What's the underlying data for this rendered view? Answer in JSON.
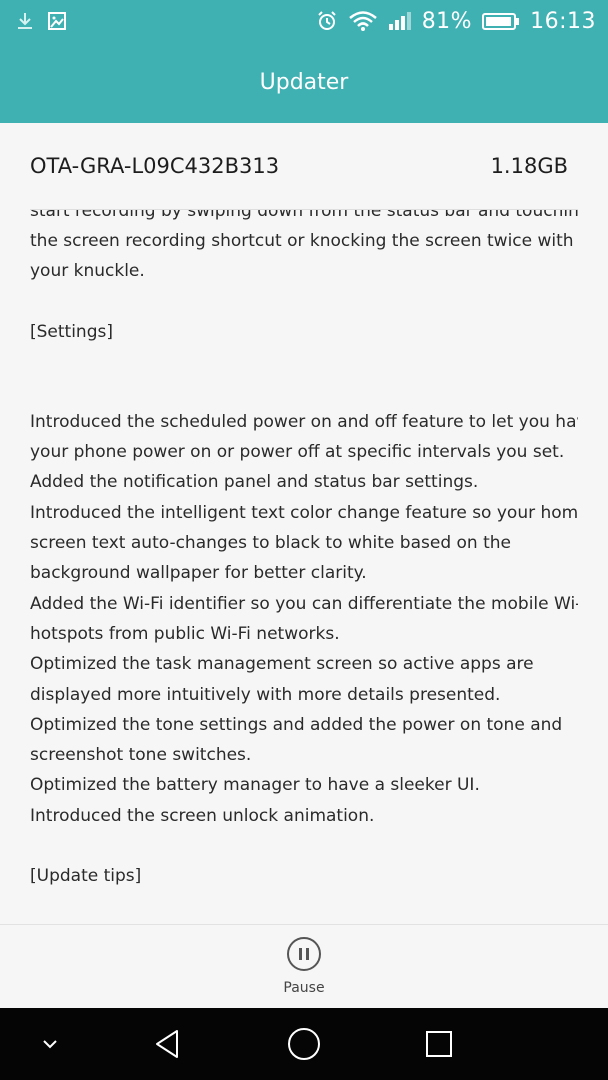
{
  "status_bar": {
    "battery_percent": "81%",
    "time": "16:13",
    "icons": [
      "download-icon",
      "image-icon",
      "alarm-icon",
      "wifi-icon",
      "signal-icon",
      "battery-icon"
    ]
  },
  "app_bar": {
    "title": "Updater"
  },
  "package": {
    "name": "OTA-GRA-L09C432B313",
    "size": "1.18GB"
  },
  "release_notes": {
    "partial_line": "start recording by swiping down from the status bar and touching",
    "lines_intro": [
      "the screen recording shortcut or knocking the screen twice with",
      "your knuckle."
    ],
    "settings_heading": "[Settings]",
    "settings_lines": [
      "Introduced the scheduled power on and off feature to let you have",
      "your phone power on or power off at specific intervals you set.",
      "Added the notification panel and status bar settings.",
      "Introduced the intelligent text color change feature so your home",
      "screen text auto-changes to black to white based on the",
      "background wallpaper for better clarity.",
      "Added the Wi-Fi identifier so you can differentiate the mobile Wi-Fi",
      "hotspots from public Wi-Fi networks.",
      "Optimized the task management screen so active apps are",
      "displayed more intuitively with more details presented.",
      "Optimized the tone settings and added the power on tone and",
      "screenshot tone switches.",
      "Optimized the battery manager to have a sleeker UI.",
      "Introduced the screen unlock animation."
    ],
    "tips_heading": "[Update tips]"
  },
  "bottom_action": {
    "label": "Pause",
    "icon": "pause-icon"
  },
  "nav_bar": {
    "icons": [
      "chevron-down-icon",
      "back-icon",
      "home-icon",
      "recents-icon"
    ]
  },
  "colors": {
    "accent": "#3fb1b3",
    "nav": "#050505",
    "background": "#f6f6f6"
  }
}
